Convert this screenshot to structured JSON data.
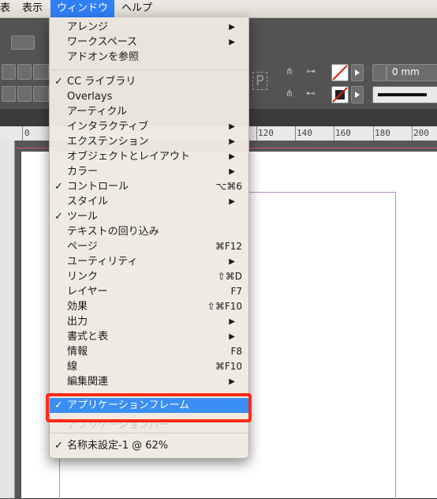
{
  "menubar": {
    "items": [
      "表",
      "表示",
      "ウィンドウ",
      "ヘルプ"
    ]
  },
  "toolbar": {
    "stroke_value": "0 mm",
    "frame_icon": "P"
  },
  "ruler": {
    "ticks": [
      "0",
      "120",
      "140",
      "160",
      "180",
      "200"
    ]
  },
  "menu": {
    "title": "ウィンドウ",
    "items": [
      {
        "label": "アレンジ",
        "checked": false,
        "submenu": true,
        "shortcut": ""
      },
      {
        "label": "ワークスペース",
        "checked": false,
        "submenu": true,
        "shortcut": ""
      },
      {
        "label": "アドオンを参照",
        "checked": false,
        "submenu": false,
        "shortcut": ""
      },
      {
        "label": "CC ライブラリ",
        "checked": true,
        "submenu": false,
        "shortcut": ""
      },
      {
        "label": "Overlays",
        "checked": false,
        "submenu": false,
        "shortcut": ""
      },
      {
        "label": "アーティクル",
        "checked": false,
        "submenu": false,
        "shortcut": ""
      },
      {
        "label": "インタラクティブ",
        "checked": false,
        "submenu": true,
        "shortcut": ""
      },
      {
        "label": "エクステンション",
        "checked": false,
        "submenu": true,
        "shortcut": ""
      },
      {
        "label": "オブジェクトとレイアウト",
        "checked": false,
        "submenu": true,
        "shortcut": ""
      },
      {
        "label": "カラー",
        "checked": false,
        "submenu": true,
        "shortcut": ""
      },
      {
        "label": "コントロール",
        "checked": true,
        "submenu": false,
        "shortcut": "⌥⌘6"
      },
      {
        "label": "スタイル",
        "checked": false,
        "submenu": true,
        "shortcut": ""
      },
      {
        "label": "ツール",
        "checked": true,
        "submenu": false,
        "shortcut": ""
      },
      {
        "label": "テキストの回り込み",
        "checked": false,
        "submenu": false,
        "shortcut": ""
      },
      {
        "label": "ページ",
        "checked": false,
        "submenu": false,
        "shortcut": "⌘F12"
      },
      {
        "label": "ユーティリティ",
        "checked": false,
        "submenu": true,
        "shortcut": ""
      },
      {
        "label": "リンク",
        "checked": false,
        "submenu": false,
        "shortcut": "⇧⌘D"
      },
      {
        "label": "レイヤー",
        "checked": false,
        "submenu": false,
        "shortcut": "F7"
      },
      {
        "label": "効果",
        "checked": false,
        "submenu": false,
        "shortcut": "⇧⌘F10"
      },
      {
        "label": "出力",
        "checked": false,
        "submenu": true,
        "shortcut": ""
      },
      {
        "label": "書式と表",
        "checked": false,
        "submenu": true,
        "shortcut": ""
      },
      {
        "label": "情報",
        "checked": false,
        "submenu": false,
        "shortcut": "F8"
      },
      {
        "label": "線",
        "checked": false,
        "submenu": false,
        "shortcut": "⌘F10"
      },
      {
        "label": "編集関連",
        "checked": false,
        "submenu": true,
        "shortcut": ""
      }
    ],
    "app_frame": {
      "label": "アプリケーションフレーム",
      "checked": true
    },
    "app_bar_ghost": "アプリケーションバー",
    "document": {
      "label": "名称未設定-1 @ 62%",
      "checked": true
    }
  },
  "colors": {
    "highlight": "#3b8ef3",
    "annotation": "#ff2a1a",
    "menubar_active": "#2f7ff7"
  }
}
